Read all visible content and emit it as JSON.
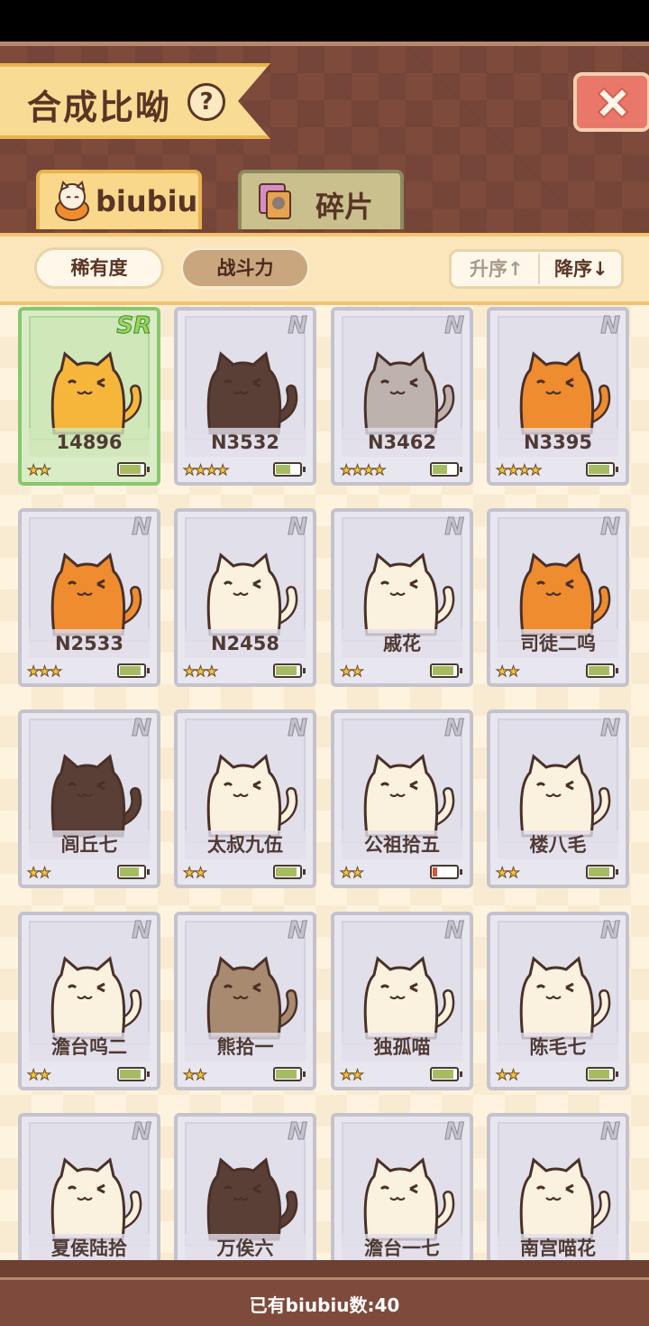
{
  "header": {
    "title": "合成比呦",
    "help_icon": "question-icon",
    "close_icon": "close-x-icon"
  },
  "tabs": [
    {
      "label": "biubiu",
      "icon": "cat-icon",
      "active": true
    },
    {
      "label": "碎片",
      "icon": "fragment-icon",
      "active": false
    }
  ],
  "sort": {
    "rarity_label": "稀有度",
    "power_label": "战斗力",
    "asc_label": "升序",
    "desc_label": "降序",
    "selected": "战斗力"
  },
  "cards": [
    {
      "name": "14896",
      "rarity": "SR",
      "stars": 2,
      "battery": 0.9,
      "color": "#f6b63c"
    },
    {
      "name": "N3532",
      "rarity": "N",
      "stars": 4,
      "battery": 0.6,
      "color": "#5a3f36"
    },
    {
      "name": "N3462",
      "rarity": "N",
      "stars": 4,
      "battery": 0.6,
      "color": "#bdb2ae"
    },
    {
      "name": "N3395",
      "rarity": "N",
      "stars": 4,
      "battery": 0.9,
      "color": "#ef8c2f"
    },
    {
      "name": "N2533",
      "rarity": "N",
      "stars": 3,
      "battery": 0.9,
      "color": "#ef8c2f"
    },
    {
      "name": "N2458",
      "rarity": "N",
      "stars": 3,
      "battery": 0.9,
      "color": "#fbf1df"
    },
    {
      "name": "戚花",
      "rarity": "N",
      "stars": 2,
      "battery": 0.9,
      "color": "#fbf1df"
    },
    {
      "name": "司徒二呜",
      "rarity": "N",
      "stars": 2,
      "battery": 0.9,
      "color": "#ef8c2f"
    },
    {
      "name": "闾丘七",
      "rarity": "N",
      "stars": 2,
      "battery": 0.8,
      "color": "#5a3f36"
    },
    {
      "name": "太叔九伍",
      "rarity": "N",
      "stars": 2,
      "battery": 0.9,
      "color": "#fbf1df"
    },
    {
      "name": "公祖拾五",
      "rarity": "N",
      "stars": 2,
      "battery": 0.2,
      "color": "#fbf1df"
    },
    {
      "name": "楼八毛",
      "rarity": "N",
      "stars": 2,
      "battery": 0.9,
      "color": "#fbf1df"
    },
    {
      "name": "澹台呜二",
      "rarity": "N",
      "stars": 2,
      "battery": 0.9,
      "color": "#fbf1df"
    },
    {
      "name": "熊拾一",
      "rarity": "N",
      "stars": 2,
      "battery": 0.9,
      "color": "#a88a70"
    },
    {
      "name": "独孤喵",
      "rarity": "N",
      "stars": 2,
      "battery": 0.9,
      "color": "#fbf1df"
    },
    {
      "name": "陈毛七",
      "rarity": "N",
      "stars": 2,
      "battery": 0.9,
      "color": "#fbf1df"
    },
    {
      "name": "夏侯陆拾",
      "rarity": "N",
      "stars": 0,
      "battery": 0,
      "color": "#fbf1df"
    },
    {
      "name": "万俟六",
      "rarity": "N",
      "stars": 0,
      "battery": 0,
      "color": "#5a3f36"
    },
    {
      "name": "澹台一七",
      "rarity": "N",
      "stars": 0,
      "battery": 0,
      "color": "#fbf1df"
    },
    {
      "name": "南宫喵花",
      "rarity": "N",
      "stars": 0,
      "battery": 0,
      "color": "#fbf1df"
    }
  ],
  "footer": {
    "count_text": "已有biubiu数:40"
  }
}
